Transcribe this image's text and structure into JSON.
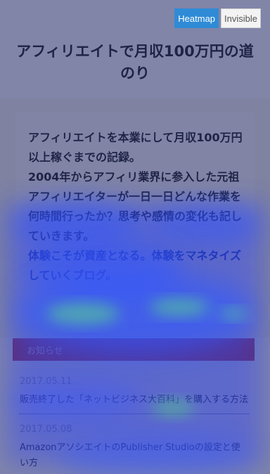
{
  "controls": {
    "heatmap_label": "Heatmap",
    "invisible_label": "Invisible",
    "accent_color": "#2f8bd6"
  },
  "site": {
    "title": "アフィリエイトで月収100万円の道のり"
  },
  "intro": {
    "line1": "アフィリエイトを本業にして月収100万円以上稼ぐまでの記録。",
    "line2": "2004年からアフィリ業界に参入した元祖アフィリエイターが一日一日どんな作業を何時間行ったか？思考や感情の変化も記していきます。",
    "line3": "体験こそが資産となる。体験をマネタイズしていくブログ。"
  },
  "notice": {
    "label": "お知らせ"
  },
  "news": [
    {
      "date": "2017.05.11",
      "title": "販売終了した「ネットビジネス大百科」を購入する方法"
    },
    {
      "date": "2017.05.08",
      "title": "AmazonアソシエイトのPublisher Studioの設定と使い方"
    }
  ]
}
